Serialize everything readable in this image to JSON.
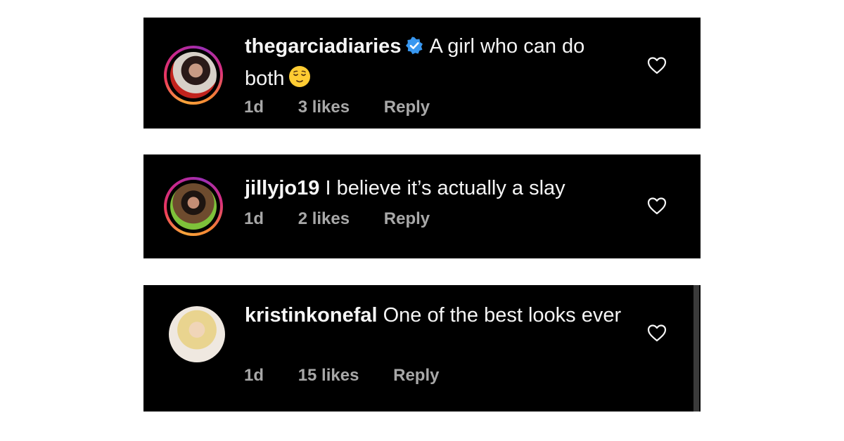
{
  "comments": [
    {
      "username": "thegarciadiaries",
      "verified": true,
      "text": "A girl who can do both",
      "emoji": "relieved-face",
      "time": "1d",
      "likes": "3 likes",
      "reply_label": "Reply",
      "story_ring": true
    },
    {
      "username": "jillyjo19",
      "verified": false,
      "text": "I believe it’s actually a slay",
      "time": "1d",
      "likes": "2 likes",
      "reply_label": "Reply",
      "story_ring": true
    },
    {
      "username": "kristinkonefal",
      "verified": false,
      "text": "One of the best looks ever",
      "time": "1d",
      "likes": "15 likes",
      "reply_label": "Reply",
      "story_ring": false
    }
  ],
  "colors": {
    "card_background": "#000000",
    "text": "#f5f5f5",
    "meta_text": "#a8a8a8",
    "verified_badge": "#3897f0"
  },
  "icons": [
    "verified-badge-icon",
    "relieved-face-emoji",
    "heart-icon"
  ]
}
